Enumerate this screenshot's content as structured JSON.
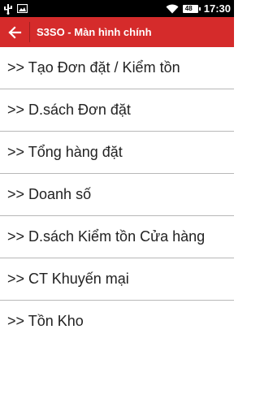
{
  "status_bar": {
    "battery_level": "48",
    "time": "17:30",
    "icons": [
      "usb-icon",
      "image-icon",
      "wifi-icon",
      "battery-icon"
    ]
  },
  "action_bar": {
    "title": "S3SO - Màn hình chính",
    "background_color": "#d52b2b"
  },
  "menu": {
    "items": [
      {
        "label": ">> Tạo Đơn đặt / Kiểm tồn"
      },
      {
        "label": ">> D.sách Đơn đặt"
      },
      {
        "label": ">> Tổng hàng đặt"
      },
      {
        "label": ">> Doanh số"
      },
      {
        "label": ">> D.sách Kiểm tồn Cửa hàng"
      },
      {
        "label": ">> CT Khuyến mại"
      },
      {
        "label": ">> Tồn Kho"
      }
    ]
  }
}
